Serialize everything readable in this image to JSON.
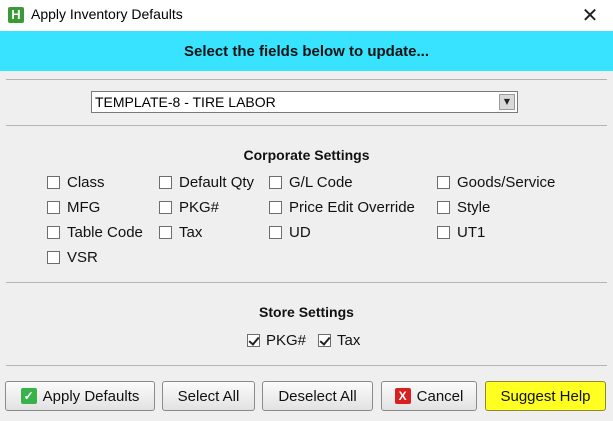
{
  "window": {
    "app_icon_letter": "H",
    "title": "Apply Inventory Defaults",
    "close_glyph": "✕"
  },
  "banner": {
    "text": "Select the fields below to update...",
    "color": "#38e3ff"
  },
  "template_select": {
    "value": "TEMPLATE-8 - TIRE LABOR",
    "arrow_glyph": "▼"
  },
  "corporate": {
    "title": "Corporate Settings",
    "items": [
      {
        "label": "Class",
        "checked": false
      },
      {
        "label": "Default Qty",
        "checked": false
      },
      {
        "label": "G/L Code",
        "checked": false
      },
      {
        "label": "Goods/Service",
        "checked": false
      },
      {
        "label": "MFG",
        "checked": false
      },
      {
        "label": "PKG#",
        "checked": false
      },
      {
        "label": "Price Edit Override",
        "checked": false
      },
      {
        "label": "Style",
        "checked": false
      },
      {
        "label": "Table Code",
        "checked": false
      },
      {
        "label": "Tax",
        "checked": false
      },
      {
        "label": "UD",
        "checked": false
      },
      {
        "label": "UT1",
        "checked": false
      },
      {
        "label": "VSR",
        "checked": false
      }
    ]
  },
  "store": {
    "title": "Store Settings",
    "items": [
      {
        "label": "PKG#",
        "checked": true
      },
      {
        "label": "Tax",
        "checked": true
      }
    ]
  },
  "buttons": {
    "apply": "Apply Defaults",
    "select_all": "Select All",
    "deselect_all": "Deselect All",
    "cancel": "Cancel",
    "suggest_help": "Suggest Help",
    "apply_icon": "✓",
    "cancel_icon": "X",
    "help_color": "#ffff22"
  }
}
